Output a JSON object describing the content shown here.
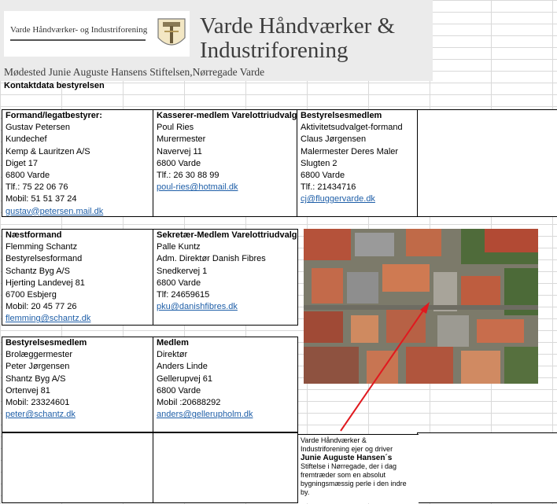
{
  "header": {
    "logo_text": "Varde Håndværker- og Industriforening",
    "title_line1": "Varde Håndværker &",
    "title_line2": "Industriforening",
    "meeting_place": "Mødested Junie Auguste Hansens Stiftelsen,Nørregade Varde"
  },
  "section_title": "Kontaktdata bestyrelsen",
  "board": [
    {
      "role": "Formand/legatbestyrer:",
      "lines": [
        "Gustav Petersen",
        "Kundechef",
        "Kemp & Lauritzen A/S",
        "Diget 17",
        "6800 Varde",
        "Tlf.: 75 22 06 76",
        "Mobil: 51 51 37 24"
      ],
      "email": "gustav@petersen.mail.dk"
    },
    {
      "role": "Kasserer-medlem Varelottriudvalg",
      "lines": [
        "Poul Ries",
        "Murermester",
        "Navervej 11",
        "6800 Varde",
        "Tlf.: 26 30 88 99"
      ],
      "email": "poul-ries@hotmail.dk"
    },
    {
      "role": "Bestyrelsesmedlem",
      "lines": [
        "Aktivitetsudvalget-formand",
        "Claus Jørgensen",
        "Malermester Deres Maler",
        "Slugten 2",
        "6800 Varde",
        "Tlf.: 21434716"
      ],
      "email": "cj@fluggervarde.dk"
    },
    {
      "role": "Næstformand",
      "lines": [
        "Flemming Schantz",
        "Bestyrelsesformand",
        "Schantz Byg A/S",
        "Hjerting Landevej 81",
        "6700 Esbjerg",
        "Mobil: 20 45 77 26"
      ],
      "email": "flemming@schantz.dk"
    },
    {
      "role": "Sekretær-Medlem Varelottriudvalg",
      "lines": [
        "Palle Kuntz",
        "Adm. Direktør Danish Fibres",
        "Snedkervej 1",
        "6800 Varde",
        "Tlf: 24659615"
      ],
      "email": "pku@danishfibres.dk"
    },
    {
      "role": "Bestyrelsesmedlem",
      "lines": [
        "Brolæggermester",
        "Peter Jørgensen",
        "Shantz Byg A/S",
        "Ortenvej 81",
        "Mobil: 23324601"
      ],
      "email": "peter@schantz.dk"
    },
    {
      "role": "Medlem",
      "lines": [
        "Direktør",
        "Anders Linde",
        "Gellerupvej  61",
        "6800 Varde",
        "Mobil :20688292"
      ],
      "email": "anders@gellerupholm.dk"
    }
  ],
  "caption": {
    "part1": "Varde Håndværker & Industriforening ejer og driver",
    "bold": "Junie Auguste Hansen´s",
    "part2": "Stiftelse i Nørregade, der i dag fremtræder som en absolut bygningsmæssig perle i den indre by."
  },
  "colors": {
    "link": "#1f5fa8",
    "arrow": "#e0191f",
    "banner": "#ebebeb"
  },
  "icons": {
    "emblem": "guild-hammer-emblem-icon"
  }
}
